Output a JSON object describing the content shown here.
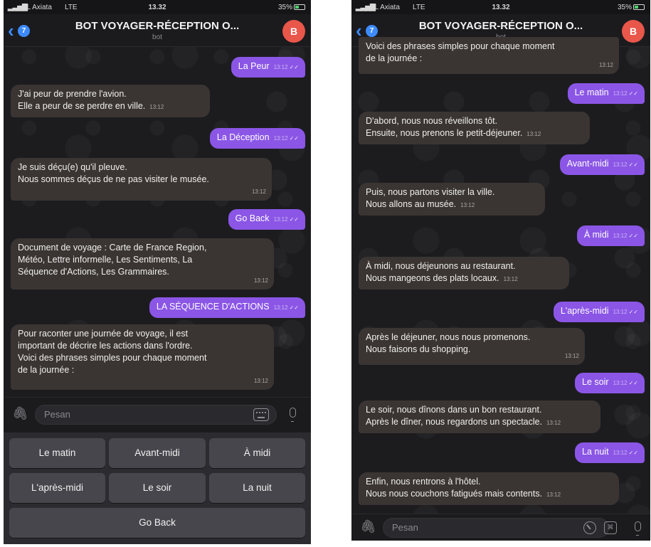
{
  "status": {
    "carrier": "XL Axiata",
    "network": "LTE",
    "time": "13.32",
    "battery": "35%"
  },
  "header": {
    "back_badge": "7",
    "title": "BOT VOYAGER-RÉCEPTION O...",
    "subtitle": "bot",
    "avatar_letter": "B"
  },
  "left": {
    "messages": [
      {
        "dir": "out",
        "text": "La Peur",
        "time": "13:12"
      },
      {
        "dir": "in",
        "text": "J'ai peur de prendre l'avion.\nElle a peur de se perdre en ville.",
        "time": "13:12"
      },
      {
        "dir": "out",
        "text": "La Déception",
        "time": "13:12"
      },
      {
        "dir": "in",
        "text": "Je suis déçu(e) qu'il pleuve.\nNous sommes déçus de ne pas visiter le musée.",
        "time": "13:12"
      },
      {
        "dir": "out",
        "text": "Go Back",
        "time": "13:12"
      },
      {
        "dir": "in",
        "text": "Document de voyage : Carte de France Region,\nMétéo, Lettre informelle, Les Sentiments, La\nSéquence d'Actions, Les Grammaires.",
        "time": "13:12"
      },
      {
        "dir": "out",
        "text": "LA SÉQUENCE D'ACTIONS",
        "time": "13:12"
      },
      {
        "dir": "in",
        "text": "Pour raconter une journée de voyage, il est\nimportant de décrire les actions dans l'ordre.\nVoici des phrases simples pour chaque moment\nde la journée :",
        "time": "13:12"
      }
    ],
    "input_placeholder": "Pesan",
    "keyboard": {
      "rows": [
        [
          "Le matin",
          "Avant-midi",
          "À midi"
        ],
        [
          "L'après-midi",
          "Le soir",
          "La nuit"
        ],
        [
          "Go Back"
        ]
      ]
    }
  },
  "right": {
    "messages": [
      {
        "dir": "in",
        "text": "Voici des phrases simples pour chaque moment\nde la journée :",
        "time": "13:12"
      },
      {
        "dir": "out",
        "text": "Le matin",
        "time": "13:12"
      },
      {
        "dir": "in",
        "text": "D'abord, nous nous réveillons tôt.\nEnsuite, nous prenons le petit-déjeuner.",
        "time": "13:12"
      },
      {
        "dir": "out",
        "text": "Avant-midi",
        "time": "13:12"
      },
      {
        "dir": "in",
        "text": "Puis, nous partons visiter la ville.\nNous allons au musée.",
        "time": "13:12"
      },
      {
        "dir": "out",
        "text": "À midi",
        "time": "13:12"
      },
      {
        "dir": "in",
        "text": "À midi, nous déjeunons au restaurant.\nNous mangeons des plats locaux.",
        "time": "13:12"
      },
      {
        "dir": "out",
        "text": "L'après-midi",
        "time": "13:12"
      },
      {
        "dir": "in",
        "text": "Après le déjeuner, nous nous promenons.\nNous faisons du shopping.",
        "time": "13:12"
      },
      {
        "dir": "out",
        "text": "Le soir",
        "time": "13:12"
      },
      {
        "dir": "in",
        "text": "Le soir, nous dînons dans un bon restaurant.\nAprès le dîner, nous regardons un spectacle.",
        "time": "13:12"
      },
      {
        "dir": "out",
        "text": "La nuit",
        "time": "13:12"
      },
      {
        "dir": "in",
        "text": "Enfin, nous rentrons à l'hôtel.\nNous nous couchons fatigués mais contents.",
        "time": "13:12"
      }
    ],
    "input_placeholder": "Pesan"
  },
  "colors": {
    "incoming": "#3a3533",
    "outgoing": "#8b56e6",
    "accent": "#3d8bff",
    "avatar": "#e9564a"
  },
  "icons": {
    "attach": "paperclip-icon",
    "keyboard": "keyboard-icon",
    "mic": "microphone-icon",
    "sticker": "sticker-icon",
    "commands": "bot-commands-icon"
  }
}
